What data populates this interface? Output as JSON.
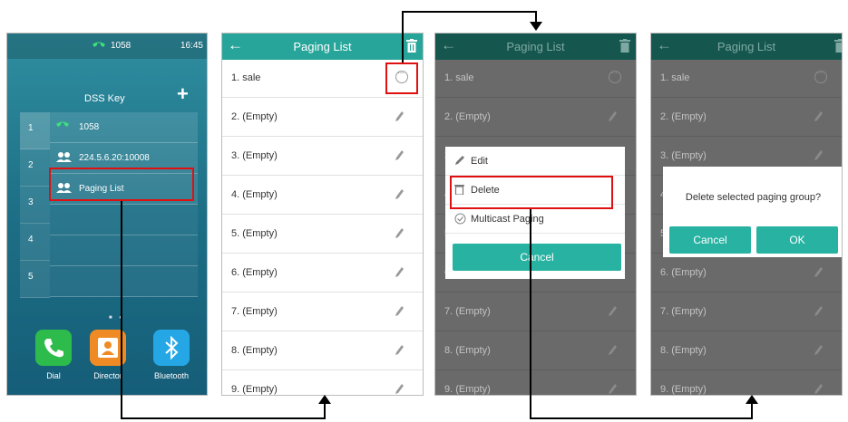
{
  "home": {
    "line_number": "1058",
    "time": "16:45",
    "dss_title": "DSS Key",
    "add_symbol": "+",
    "tabs": [
      "1",
      "2",
      "3",
      "4",
      "5"
    ],
    "keys": [
      {
        "label": "1058",
        "icon": "phone-icon"
      },
      {
        "label": "224.5.6.20:10008",
        "icon": "paging-group-icon"
      },
      {
        "label": "Paging List",
        "icon": "paging-group-icon"
      }
    ],
    "apps": [
      {
        "label": "Dial",
        "color": "#2dbb4b",
        "icon": "phone-icon"
      },
      {
        "label": "Director",
        "color": "#f08a24",
        "icon": "contact-icon"
      },
      {
        "label": "Bluetooth",
        "color": "#25a7e6",
        "icon": "bluetooth-icon"
      }
    ],
    "page_dots": "■ ●"
  },
  "paging": {
    "title": "Paging List",
    "back_symbol": "←",
    "items": [
      "1. sale",
      "2. (Empty)",
      "3. (Empty)",
      "4. (Empty)",
      "5. (Empty)",
      "6. (Empty)",
      "7. (Empty)",
      "8. (Empty)",
      "9. (Empty)"
    ]
  },
  "menu": {
    "edit": "Edit",
    "delete": "Delete",
    "multicast": "Multicast Paging",
    "cancel": "Cancel"
  },
  "dialog": {
    "message": "Delete selected paging group?",
    "cancel": "Cancel",
    "ok": "OK"
  },
  "colors": {
    "accent": "#27a59a",
    "highlight": "#e01010"
  }
}
